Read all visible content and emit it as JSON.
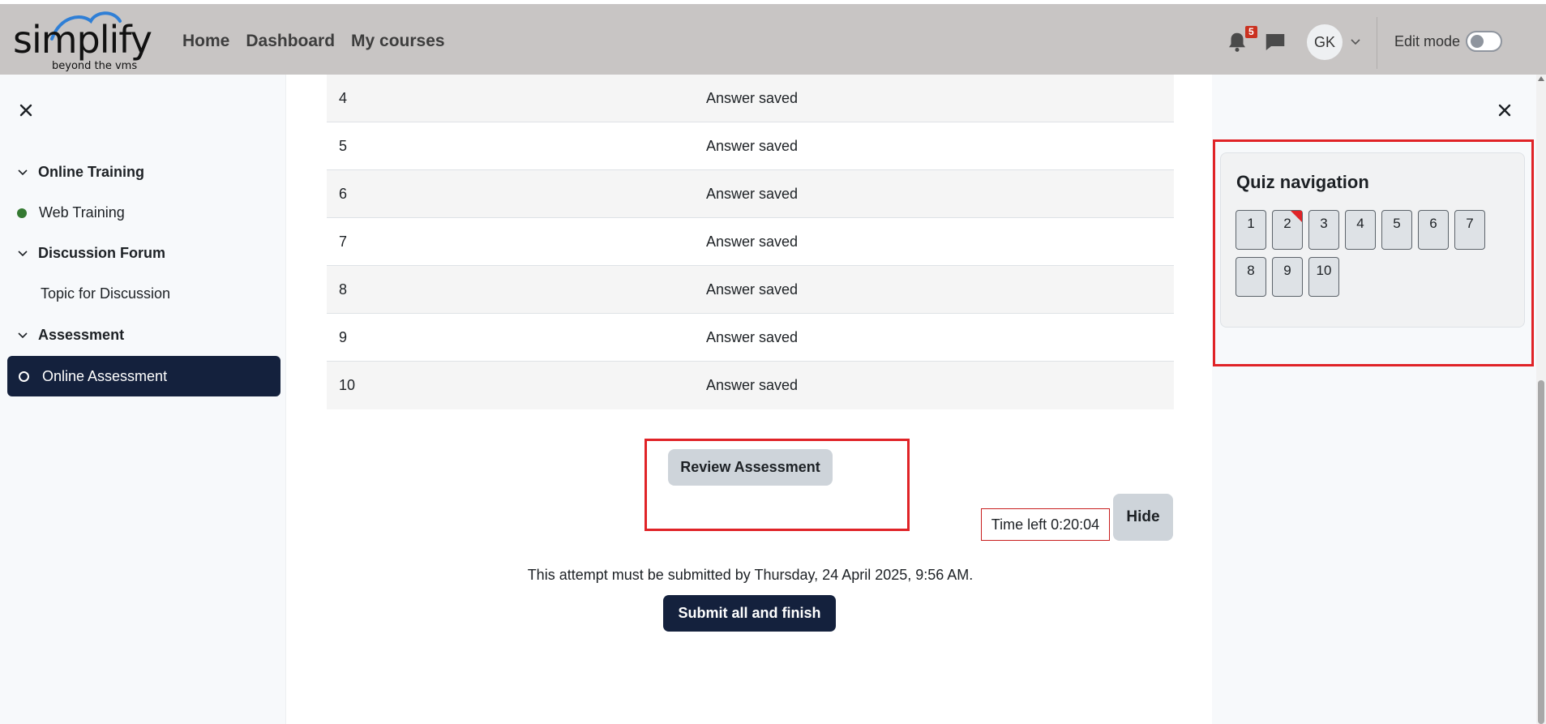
{
  "header": {
    "logo_text": "simplify",
    "logo_sub": "beyond the vms",
    "nav": [
      "Home",
      "Dashboard",
      "My courses"
    ],
    "notification_count": "5",
    "avatar_initials": "GK",
    "edit_mode_label": "Edit mode",
    "edit_mode_on": false
  },
  "course_index": {
    "items": [
      {
        "type": "section",
        "label": "Online Training"
      },
      {
        "type": "activity",
        "label": "Web Training",
        "status": "complete",
        "status_color": "#357a32"
      },
      {
        "type": "section",
        "label": "Discussion Forum"
      },
      {
        "type": "activity",
        "label": "Topic for Discussion",
        "status": "none"
      },
      {
        "type": "section",
        "label": "Assessment"
      }
    ],
    "active_item": "Online Assessment"
  },
  "summary_table": {
    "rows": [
      {
        "question": "4",
        "status": "Answer saved"
      },
      {
        "question": "5",
        "status": "Answer saved"
      },
      {
        "question": "6",
        "status": "Answer saved"
      },
      {
        "question": "7",
        "status": "Answer saved"
      },
      {
        "question": "8",
        "status": "Answer saved"
      },
      {
        "question": "9",
        "status": "Answer saved"
      },
      {
        "question": "10",
        "status": "Answer saved"
      }
    ]
  },
  "actions": {
    "review_label": "Review Assessment",
    "time_left": "Time left 0:20:04",
    "hide_label": "Hide",
    "submit_note": "This attempt must be submitted by Thursday, 24 April 2025, 9:56 AM.",
    "submit_label": "Submit all and finish"
  },
  "quiz_navigation": {
    "title": "Quiz navigation",
    "buttons": [
      "1",
      "2",
      "3",
      "4",
      "5",
      "6",
      "7",
      "8",
      "9",
      "10"
    ],
    "flagged": [
      "2"
    ]
  },
  "colors": {
    "primary": "#14213d",
    "header_bg": "#c8c5c4",
    "highlight_red": "#e02327"
  }
}
